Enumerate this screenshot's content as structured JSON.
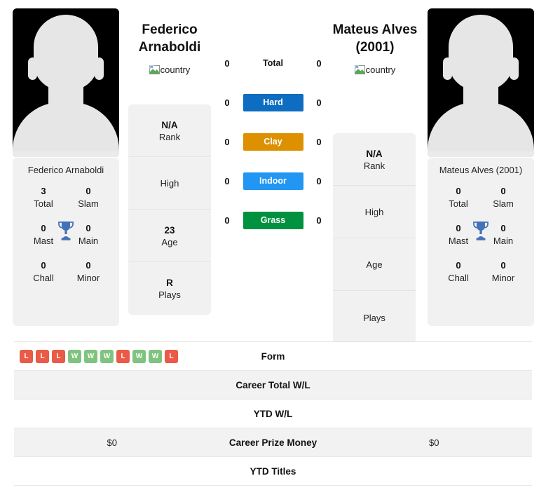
{
  "players": {
    "left": {
      "name_line1": "Federico",
      "name_line2": "Arnaboldi",
      "country_alt": "country",
      "avatar_name": "player-photo",
      "card_name": "Federico Arnaboldi",
      "info": [
        {
          "value": "N/A",
          "label": "Rank"
        },
        {
          "value": "",
          "label": "High"
        },
        {
          "value": "23",
          "label": "Age"
        },
        {
          "value": "R",
          "label": "Plays"
        }
      ],
      "titles": [
        {
          "value": "3",
          "label": "Total"
        },
        {
          "value": "0",
          "label": "Slam"
        },
        {
          "value": "0",
          "label": "Mast"
        },
        {
          "value": "0",
          "label": "Main"
        },
        {
          "value": "0",
          "label": "Chall"
        },
        {
          "value": "0",
          "label": "Minor"
        }
      ]
    },
    "right": {
      "name_line1": "Mateus Alves",
      "name_line2": "(2001)",
      "country_alt": "country",
      "avatar_name": "player-photo",
      "card_name": "Mateus Alves (2001)",
      "info": [
        {
          "value": "N/A",
          "label": "Rank"
        },
        {
          "value": "",
          "label": "High"
        },
        {
          "value": "",
          "label": "Age"
        },
        {
          "value": "",
          "label": "Plays"
        }
      ],
      "titles": [
        {
          "value": "0",
          "label": "Total"
        },
        {
          "value": "0",
          "label": "Slam"
        },
        {
          "value": "0",
          "label": "Mast"
        },
        {
          "value": "0",
          "label": "Main"
        },
        {
          "value": "0",
          "label": "Chall"
        },
        {
          "value": "0",
          "label": "Minor"
        }
      ]
    }
  },
  "surfaces": [
    {
      "label": "Total",
      "left": "0",
      "right": "0",
      "color": "transparent",
      "text_color": "#111111"
    },
    {
      "label": "Hard",
      "left": "0",
      "right": "0",
      "color": "#0d6dc0",
      "text_color": "#ffffff"
    },
    {
      "label": "Clay",
      "left": "0",
      "right": "0",
      "color": "#dd9000",
      "text_color": "#ffffff"
    },
    {
      "label": "Indoor",
      "left": "0",
      "right": "0",
      "color": "#2196f3",
      "text_color": "#ffffff"
    },
    {
      "label": "Grass",
      "left": "0",
      "right": "0",
      "color": "#00923f",
      "text_color": "#ffffff"
    }
  ],
  "form": {
    "label": "Form",
    "results": [
      "L",
      "L",
      "L",
      "W",
      "W",
      "W",
      "L",
      "W",
      "W",
      "L"
    ],
    "win_color": "#7ec47e",
    "loss_color": "#ea5a47"
  },
  "comparison_rows": [
    {
      "label": "Form",
      "left": "",
      "right": ""
    },
    {
      "label": "Career Total W/L",
      "left": "",
      "right": ""
    },
    {
      "label": "YTD W/L",
      "left": "",
      "right": ""
    },
    {
      "label": "Career Prize Money",
      "left": "$0",
      "right": "$0"
    },
    {
      "label": "YTD Titles",
      "left": "",
      "right": ""
    }
  ],
  "colors": {
    "trophy": "#4472b8",
    "card_bg": "#f1f1f1",
    "stripe_bg": "#f2f2f2"
  }
}
